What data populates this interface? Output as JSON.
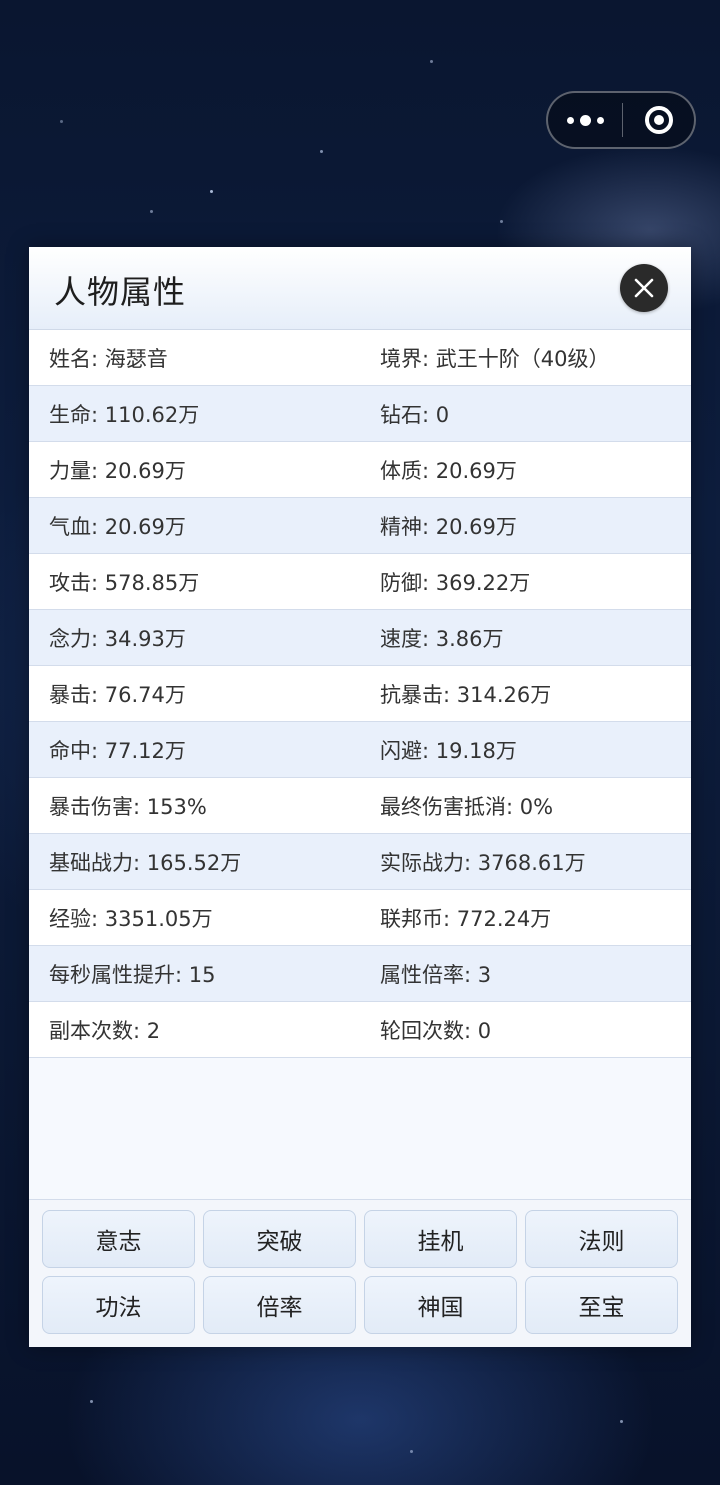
{
  "window": {
    "title": "人物属性",
    "close_icon": "close-icon"
  },
  "capsule": {
    "more_icon": "more-dots-icon",
    "target_icon": "target-icon"
  },
  "rows": [
    [
      {
        "label": "姓名",
        "value": "海瑟音"
      },
      {
        "label": "境界",
        "value": "武王十阶（40级）"
      }
    ],
    [
      {
        "label": "生命",
        "value": "110.62万"
      },
      {
        "label": "钻石",
        "value": "0"
      }
    ],
    [
      {
        "label": "力量",
        "value": "20.69万"
      },
      {
        "label": "体质",
        "value": "20.69万"
      }
    ],
    [
      {
        "label": "气血",
        "value": "20.69万"
      },
      {
        "label": "精神",
        "value": "20.69万"
      }
    ],
    [
      {
        "label": "攻击",
        "value": "578.85万"
      },
      {
        "label": "防御",
        "value": "369.22万"
      }
    ],
    [
      {
        "label": "念力",
        "value": "34.93万"
      },
      {
        "label": "速度",
        "value": "3.86万"
      }
    ],
    [
      {
        "label": "暴击",
        "value": "76.74万"
      },
      {
        "label": "抗暴击",
        "value": "314.26万"
      }
    ],
    [
      {
        "label": "命中",
        "value": "77.12万"
      },
      {
        "label": "闪避",
        "value": "19.18万"
      }
    ],
    [
      {
        "label": "暴击伤害",
        "value": "153%"
      },
      {
        "label": "最终伤害抵消",
        "value": "0%"
      }
    ],
    [
      {
        "label": "基础战力",
        "value": "165.52万"
      },
      {
        "label": "实际战力",
        "value": "3768.61万"
      }
    ],
    [
      {
        "label": "经验",
        "value": "3351.05万"
      },
      {
        "label": "联邦币",
        "value": "772.24万"
      }
    ],
    [
      {
        "label": "每秒属性提升",
        "value": "15"
      },
      {
        "label": "属性倍率",
        "value": "3"
      }
    ],
    [
      {
        "label": "副本次数",
        "value": "2"
      },
      {
        "label": "轮回次数",
        "value": "0"
      }
    ]
  ],
  "buttons": [
    "意志",
    "突破",
    "挂机",
    "法则",
    "功法",
    "倍率",
    "神国",
    "至宝"
  ]
}
